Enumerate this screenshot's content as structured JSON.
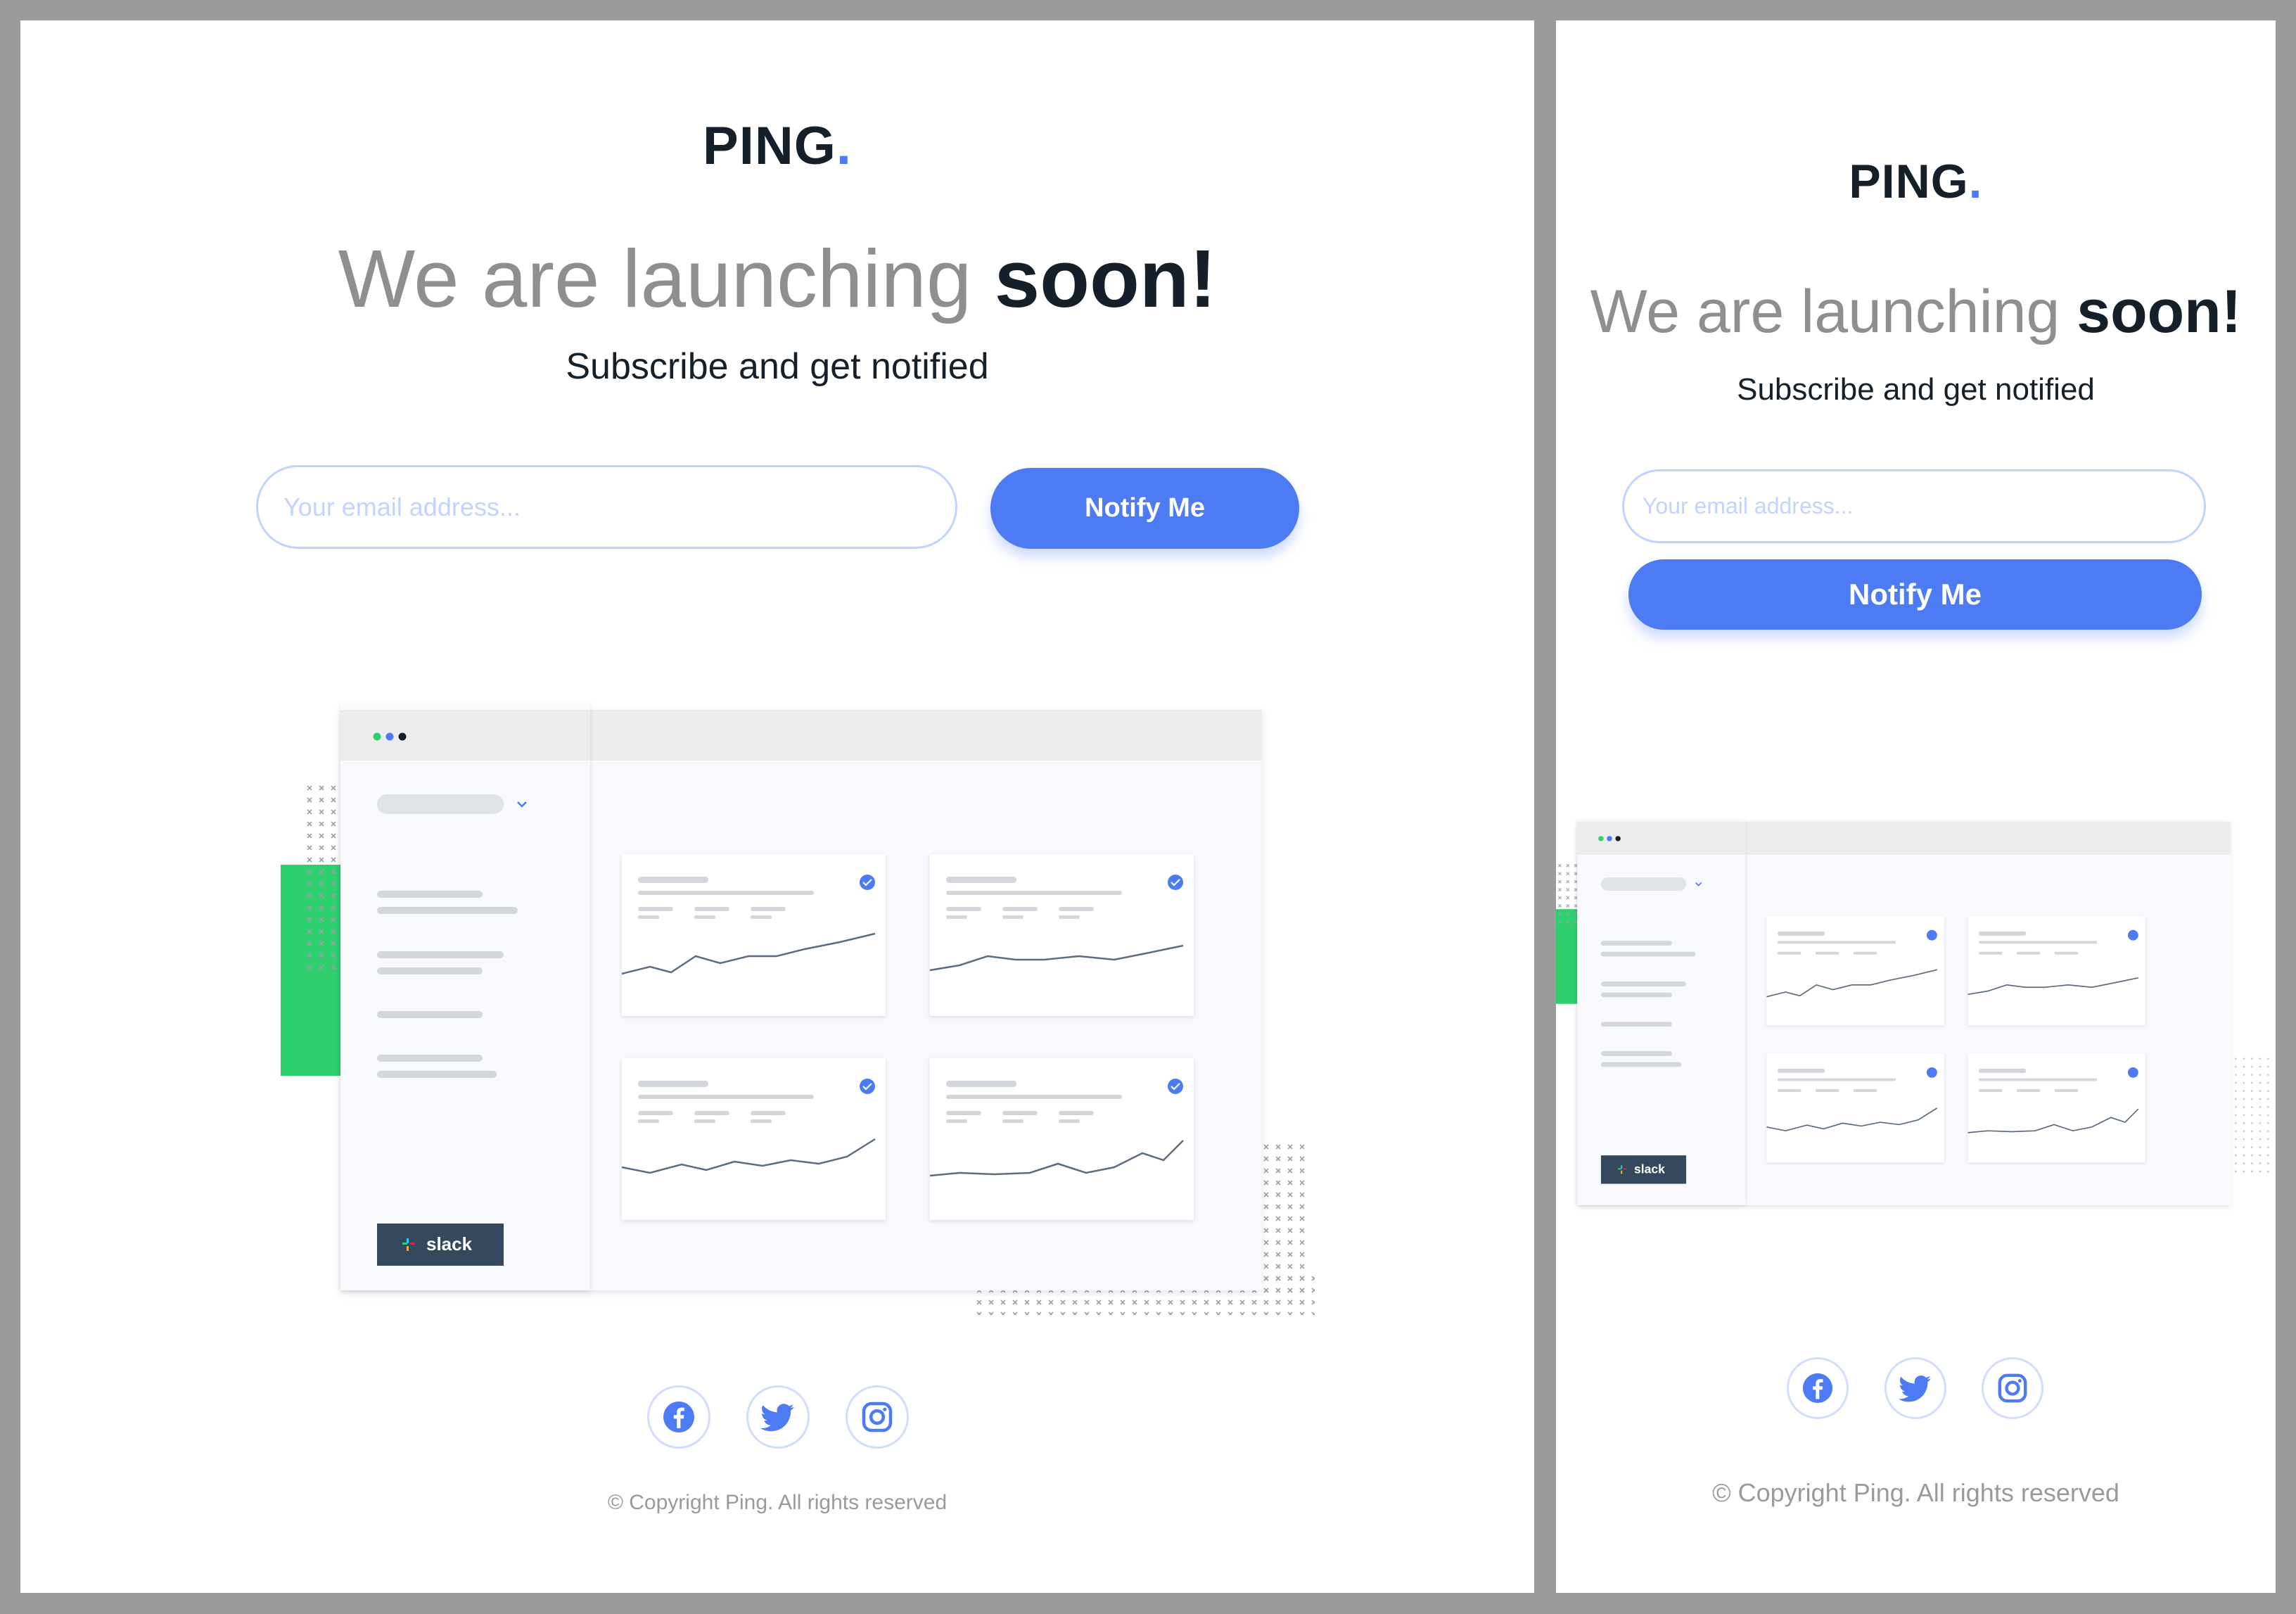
{
  "brand": {
    "name": "PING",
    "dot": "."
  },
  "hero": {
    "headline_light": "We are launching ",
    "headline_bold": "soon!",
    "subtitle": "Subscribe and get notified"
  },
  "form": {
    "email_placeholder": "Your email address...",
    "email_value": "",
    "submit_label": "Notify Me"
  },
  "dashboard": {
    "integration_label": "slack",
    "window_dots": [
      "#2ed06e",
      "#4c7bf3",
      "#15202a"
    ]
  },
  "social": [
    {
      "icon": "facebook-icon"
    },
    {
      "icon": "twitter-icon"
    },
    {
      "icon": "instagram-icon"
    }
  ],
  "footer": {
    "copyright": "© Copyright Ping. All rights reserved"
  },
  "colors": {
    "accent": "#4c7bf3",
    "text_dark": "#15202a",
    "text_gray": "#8f8f8f",
    "input_border": "#c2d3ff",
    "green": "#2ed06e"
  }
}
